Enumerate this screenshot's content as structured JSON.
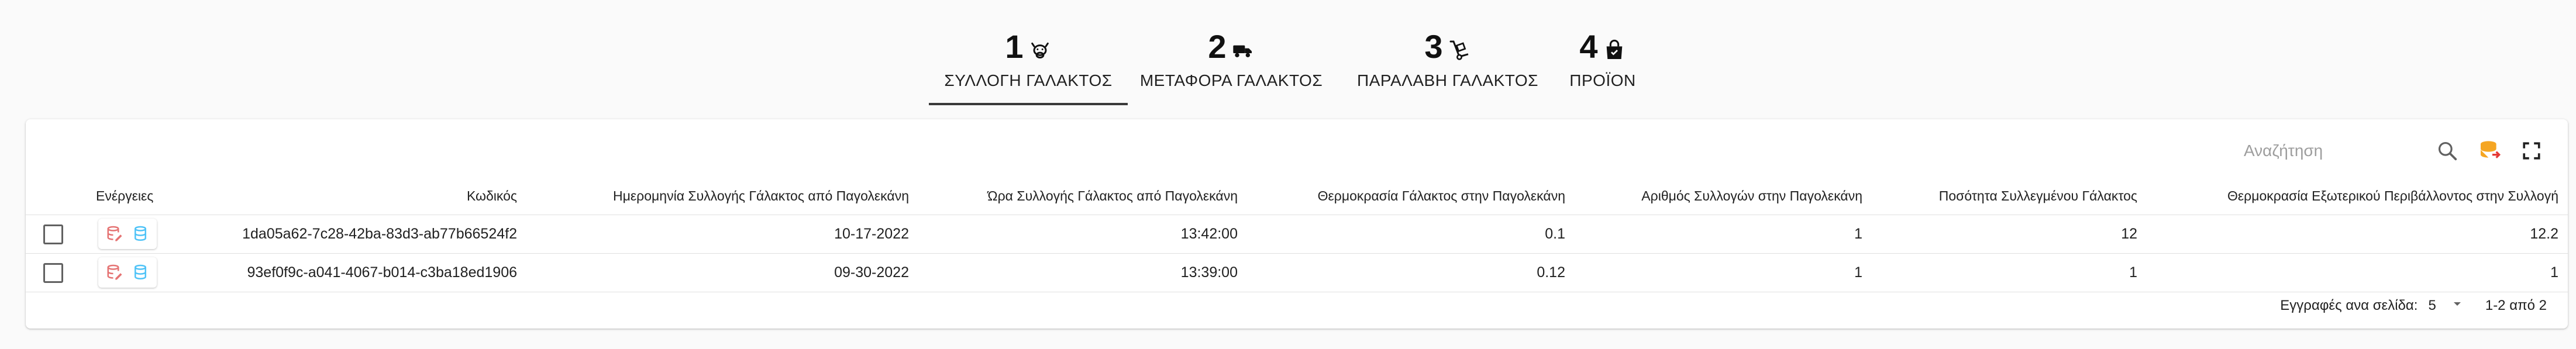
{
  "stepper": {
    "steps": [
      {
        "number": "1",
        "label": "ΣΥΛΛΟΓΗ ΓΑΛΑΚΤΟΣ",
        "icon": "cow-icon",
        "active": true
      },
      {
        "number": "2",
        "label": "ΜΕΤΑΦΟΡΑ ΓΑΛΑΚΤΟΣ",
        "icon": "truck-icon",
        "active": false
      },
      {
        "number": "3",
        "label": "ΠΑΡΑΛΑΒΗ ΓΑΛΑΚΤΟΣ",
        "icon": "hand-truck-icon",
        "active": false
      },
      {
        "number": "4",
        "label": "ΠΡΟΪΟΝ",
        "icon": "shopping-bag-icon",
        "active": false
      }
    ]
  },
  "toolbar": {
    "search_placeholder": "Αναζήτηση",
    "icons": [
      "search-icon",
      "database-export-icon",
      "fullscreen-icon"
    ]
  },
  "table": {
    "columns": {
      "actions": "Ενέργειες",
      "code": "Κωδικός",
      "date": "Ημερομηνία Συλλογής Γάλακτος από Παγολεκάνη",
      "time": "Ώρα Συλλογής Γάλακτος από Παγολεκάνη",
      "temp": "Θερμοκρασία Γάλακτος στην Παγολεκάνη",
      "count": "Αριθμός Συλλογών στην Παγολεκάνη",
      "qty": "Ποσότητα Συλλεγμένου Γάλακτος",
      "ext": "Θερμοκρασία Εξωτερικού Περιβάλλοντος στην Συλλογή"
    },
    "rows": [
      {
        "code": "1da05a62-7c28-42ba-83d3-ab77b66524f2",
        "date": "10-17-2022",
        "time": "13:42:00",
        "temp": "0.1",
        "count": "1",
        "qty": "12",
        "ext": "12.2"
      },
      {
        "code": "93ef0f9c-a041-4067-b014-c3ba18ed1906",
        "date": "09-30-2022",
        "time": "13:39:00",
        "temp": "0.12",
        "count": "1",
        "qty": "1",
        "ext": "1"
      }
    ]
  },
  "footer": {
    "rows_per_page_label": "Εγγραφές ανα σελίδα:",
    "rows_per_page_value": "5",
    "range": "1-2 από 2"
  },
  "colors": {
    "edit_icon": "#e57373",
    "db_icon": "#4fc3f7",
    "export_icon": "#f5a623",
    "active_underline": "#3a3a3a"
  }
}
